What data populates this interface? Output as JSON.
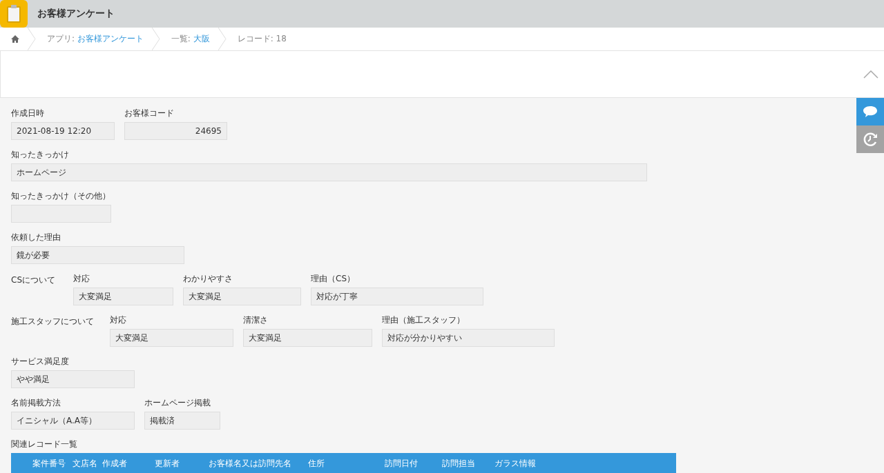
{
  "app": {
    "title": "お客様アンケート"
  },
  "breadcrumbs": [
    {
      "label": "アプリ: ",
      "link": "お客様アンケート"
    },
    {
      "label": "一覧: ",
      "link": "大阪"
    },
    {
      "label": "レコード: 18"
    }
  ],
  "rows": [
    {
      "fields": [
        {
          "label": "作成日時",
          "value": "2021-08-19 12:20",
          "kind": "text"
        },
        {
          "label": "お客様コード",
          "value": "24695",
          "kind": "number"
        }
      ]
    },
    {
      "fields": [
        {
          "label": "知ったきっかけ",
          "value": "ホームページ",
          "kind": "text"
        }
      ]
    },
    {
      "fields": [
        {
          "label": "知ったきっかけ（その他）",
          "kind": "text"
        }
      ]
    },
    {
      "fields": [
        {
          "label": "依頼した理由",
          "value": "鏡が必要",
          "kind": "text"
        }
      ]
    },
    {
      "group": "CSについて",
      "fields": [
        {
          "label": "対応",
          "value": "大変満足",
          "kind": "text"
        },
        {
          "label": "わかりやすさ",
          "value": "大変満足",
          "kind": "text"
        },
        {
          "label": "理由（CS）",
          "value": "対応が丁寧",
          "kind": "text"
        }
      ]
    },
    {
      "group": "施工スタッフについて",
      "fields": [
        {
          "label": "対応",
          "value": "大変満足",
          "kind": "text"
        },
        {
          "label": "清潔さ",
          "value": "大変満足",
          "kind": "text"
        },
        {
          "label": "理由（施工スタッフ）",
          "value": "対応が分かりやすい",
          "kind": "text"
        }
      ]
    },
    {
      "fields": [
        {
          "label": "サービス満足度",
          "value": "やや満足",
          "kind": "text"
        }
      ]
    },
    {
      "fields": [
        {
          "label": "名前掲載方法",
          "value": "イニシャル（A.A等）",
          "kind": "text"
        },
        {
          "label": "ホームページ掲載",
          "value": "掲載済",
          "kind": "text"
        }
      ]
    }
  ],
  "related": {
    "title": "関連レコード一覧",
    "columns": [
      "案件番号",
      "文店名",
      "作成者",
      "更新者",
      "お客様名又は訪問先名",
      "住所",
      "訪問日付",
      "訪問担当",
      "ガラス情報"
    ]
  }
}
